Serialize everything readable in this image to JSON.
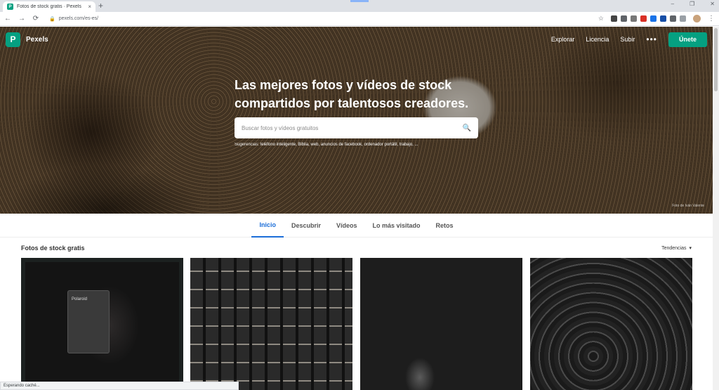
{
  "browser": {
    "tab_title": "Fotos de stock gratis · Pexels",
    "favicon_letter": "P",
    "url": "pexels.com/es-es/",
    "new_tab": "+",
    "close_tab": "×",
    "win_min": "–",
    "win_max": "❐",
    "win_close": "✕"
  },
  "nav": {
    "logo_letter": "P",
    "brand": "Pexels",
    "links": [
      "Explorar",
      "Licencia",
      "Subir"
    ],
    "more": "•••",
    "join": "Únete"
  },
  "hero": {
    "title": "Las mejores fotos y vídeos de stock compartidos por talentosos creadores.",
    "search_placeholder": "Buscar fotos y vídeos gratuitos",
    "suggestions_label": "Sugerencias:",
    "suggestions": "teléfono inteligente, Biblia, web, anuncios de facebook, ordenador portátil, trabajo, ...",
    "credit": "Foto de Iván Valente"
  },
  "tabs": [
    "Inicio",
    "Descubrir",
    "Vídeos",
    "Lo más visitado",
    "Retos"
  ],
  "section": {
    "title": "Fotos de stock gratis",
    "sort": "Tendencias"
  },
  "photo1": {
    "camera_label": "Polaroid"
  },
  "status": "Esperando caché..."
}
